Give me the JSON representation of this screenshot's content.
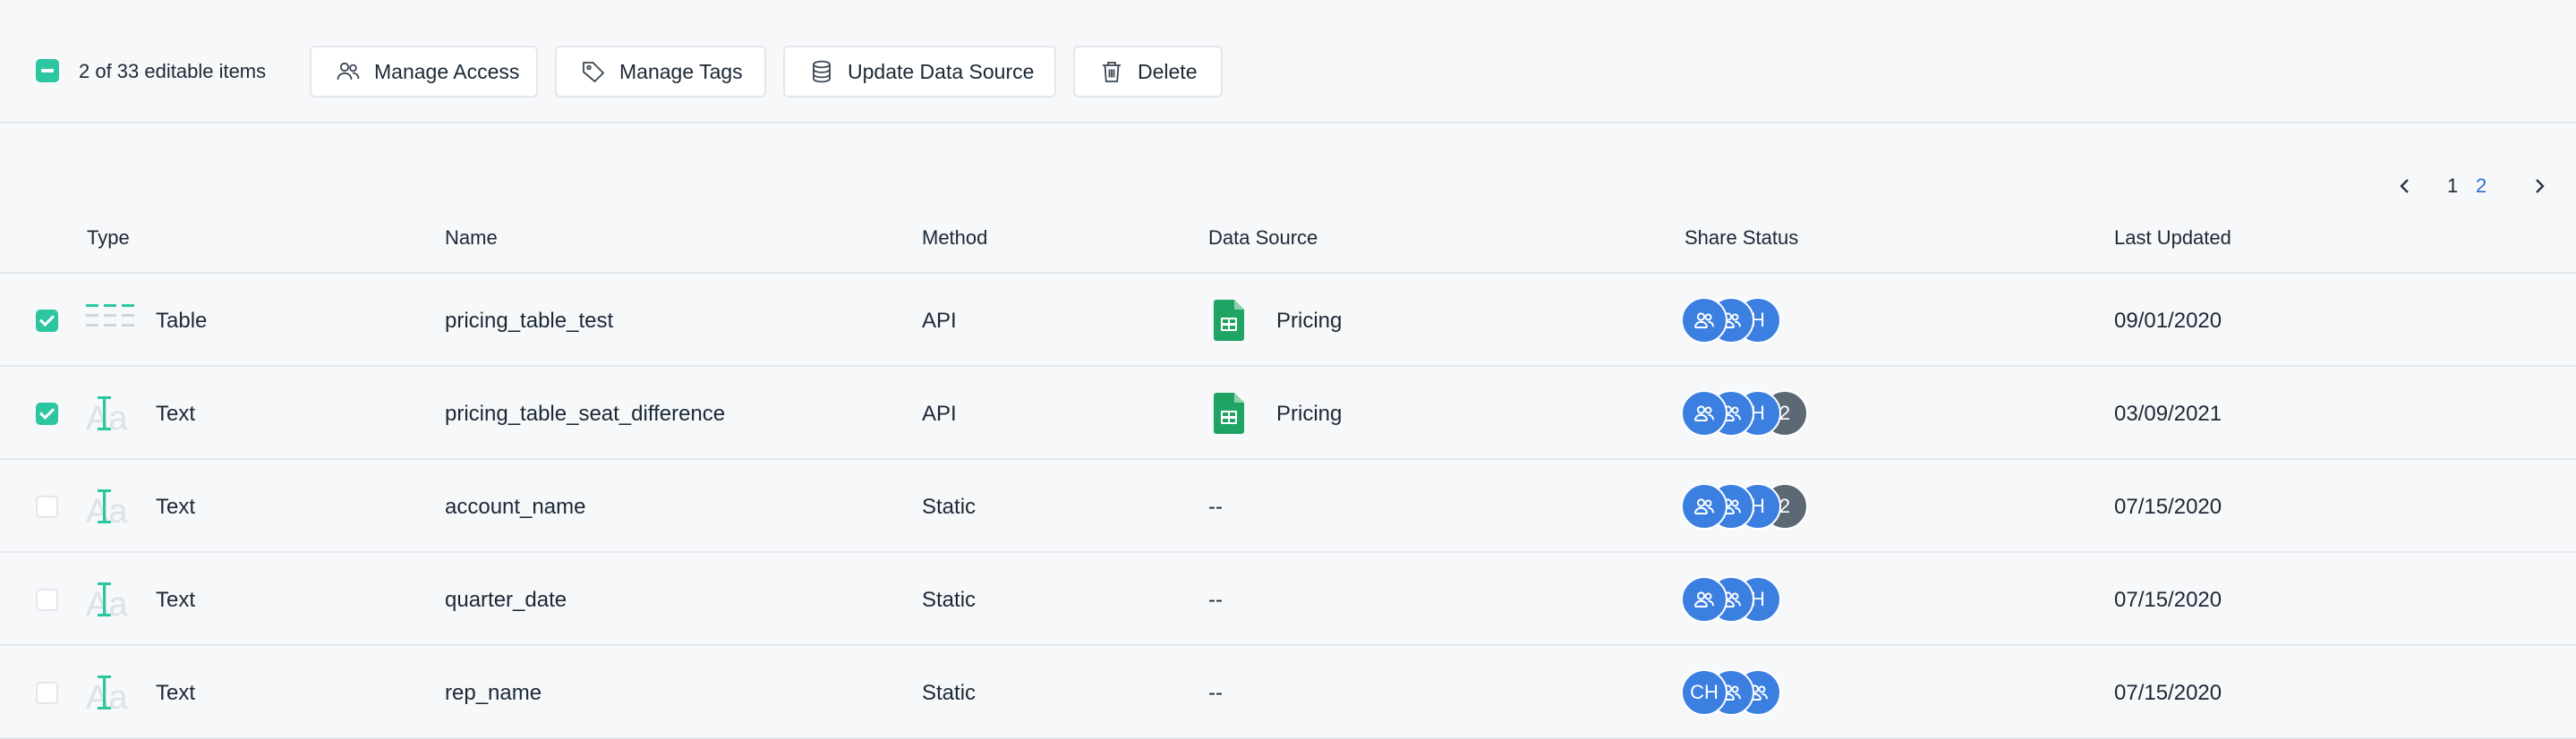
{
  "toolbar": {
    "selection_text": "2 of 33 editable items",
    "buttons": {
      "manage_access": "Manage Access",
      "manage_tags": "Manage Tags",
      "update_data_source": "Update Data Source",
      "delete": "Delete"
    }
  },
  "pagination": {
    "prev": "‹",
    "pages": [
      "1",
      "2"
    ],
    "current": "1",
    "next": "›"
  },
  "table": {
    "headers": {
      "type": "Type",
      "name": "Name",
      "method": "Method",
      "data_source": "Data Source",
      "share_status": "Share Status",
      "last_updated": "Last Updated"
    },
    "rows": [
      {
        "checked": true,
        "type": "Table",
        "type_icon": "table-icon",
        "name": "pricing_table_test",
        "method": "API",
        "data_source": "Pricing",
        "source_icon": "google-sheets-icon",
        "share": [
          "group",
          "group",
          "H"
        ],
        "last_updated": "09/01/2020"
      },
      {
        "checked": true,
        "type": "Text",
        "type_icon": "text-icon",
        "name": "pricing_table_seat_difference",
        "method": "API",
        "data_source": "Pricing",
        "source_icon": "google-sheets-icon",
        "share": [
          "group",
          "group",
          "H",
          "2"
        ],
        "last_updated": "03/09/2021"
      },
      {
        "checked": false,
        "type": "Text",
        "type_icon": "text-icon",
        "name": "account_name",
        "method": "Static",
        "data_source": "--",
        "share": [
          "group",
          "group",
          "H",
          "2"
        ],
        "last_updated": "07/15/2020"
      },
      {
        "checked": false,
        "type": "Text",
        "type_icon": "text-icon",
        "name": "quarter_date",
        "method": "Static",
        "data_source": "--",
        "share": [
          "group",
          "group",
          "H"
        ],
        "last_updated": "07/15/2020"
      },
      {
        "checked": false,
        "type": "Text",
        "type_icon": "text-icon",
        "name": "rep_name",
        "method": "Static",
        "data_source": "--",
        "share": [
          "CH",
          "group",
          "group"
        ],
        "last_updated": "07/15/2020"
      }
    ]
  },
  "colors": {
    "accent": "#2cc6a0",
    "avatar_blue": "#3b7fe1",
    "avatar_dark": "#5d6875",
    "link": "#2f6fd6",
    "sheets_green": "#1fa463"
  }
}
